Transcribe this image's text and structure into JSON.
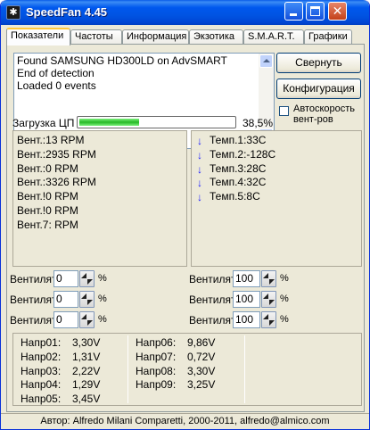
{
  "window": {
    "title": "SpeedFan 4.45",
    "icon_name": "speedfan-app-icon",
    "icon_glyph": "✱",
    "close_glyph": "✕"
  },
  "tabs": [
    {
      "label": "Показатели",
      "active": true
    },
    {
      "label": "Частоты"
    },
    {
      "label": "Информация"
    },
    {
      "label": "Экзотика"
    },
    {
      "label": "S.M.A.R.T."
    },
    {
      "label": "Графики"
    }
  ],
  "log": {
    "lines": [
      "Found SAMSUNG HD300LD on AdvSMART",
      "End of detection",
      "Loaded 0 events"
    ]
  },
  "buttons": {
    "minimize": "Свернуть",
    "configure": "Конфигурация"
  },
  "auto_fan": {
    "label": "Автоскорость вент-ров",
    "checked": false
  },
  "cpu": {
    "label": "Загрузка ЦП",
    "value_text": "38,5%",
    "fraction": 0.385
  },
  "fans": [
    "Вент.:13 RPM",
    "Вент.:2935 RPM",
    "Вент.:0 RPM",
    "Вент.:3326 RPM",
    "Вент.!0 RPM",
    "Вент.!0 RPM",
    "Вент.7: RPM"
  ],
  "temps": {
    "trend_icon": "down-arrow-icon",
    "trend_glyph": "↓",
    "trend_color": "#1818ff",
    "items": [
      "Темп.1:33C",
      "Темп.2:-128C",
      "Темп.3:28C",
      "Темп.4:32C",
      "Темп.5:8C"
    ]
  },
  "fan_controls": {
    "label": "Вентилят",
    "unit": "%",
    "left": [
      "0",
      "0",
      "0"
    ],
    "right": [
      "100",
      "100",
      "100"
    ]
  },
  "voltages": [
    [
      {
        "name": "Напр01:",
        "value": "3,30V"
      },
      {
        "name": "Напр02:",
        "value": "1,31V"
      },
      {
        "name": "Напр03:",
        "value": "2,22V"
      },
      {
        "name": "Напр04:",
        "value": "1,29V"
      },
      {
        "name": "Напр05:",
        "value": "3,45V"
      }
    ],
    [
      {
        "name": "Напр06:",
        "value": "9,86V"
      },
      {
        "name": "Напр07:",
        "value": "0,72V"
      },
      {
        "name": "Напр08:",
        "value": "3,30V"
      },
      {
        "name": "Напр09:",
        "value": "3,25V"
      }
    ]
  ],
  "footer": "Автор: Alfredo Milani Comparetti, 2000-2011, alfredo@almico.com"
}
